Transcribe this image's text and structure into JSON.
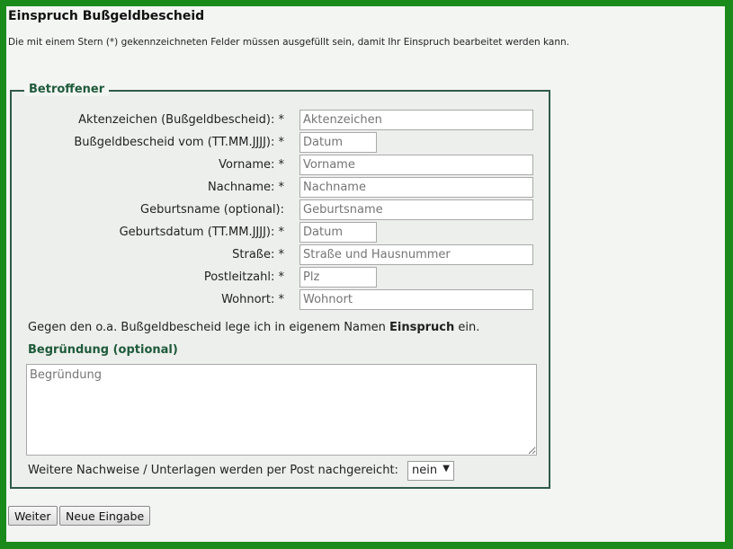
{
  "header": {
    "title": "Einspruch Bußgeldbescheid",
    "note": "Die mit einem Stern (*) gekennzeichneten Felder müssen ausgefüllt sein, damit Ihr Einspruch bearbeitet werden kann."
  },
  "form": {
    "legend": "Betroffener",
    "fields": [
      {
        "label": "Aktenzeichen (Bußgeldbescheid): *",
        "placeholder": "Aktenzeichen"
      },
      {
        "label": "Bußgeldbescheid vom (TT.MM.JJJJ): *",
        "placeholder": "Datum"
      },
      {
        "label": "Vorname: *",
        "placeholder": "Vorname"
      },
      {
        "label": "Nachname: *",
        "placeholder": "Nachname"
      },
      {
        "label": "Geburtsname (optional):",
        "placeholder": "Geburtsname"
      },
      {
        "label": "Geburtsdatum (TT.MM.JJJJ): *",
        "placeholder": "Datum"
      },
      {
        "label": "Straße: *",
        "placeholder": "Straße und Hausnummer"
      },
      {
        "label": "Postleitzahl: *",
        "placeholder": "Plz"
      },
      {
        "label": "Wohnort: *",
        "placeholder": "Wohnort"
      }
    ],
    "statement_prefix": "Gegen den o.a. Bußgeldbescheid lege ich in eigenem Namen ",
    "statement_bold": "Einspruch",
    "statement_suffix": " ein.",
    "reason_heading": "Begründung (optional)",
    "reason_placeholder": "Begründung",
    "post_label": "Weitere Nachweise / Unterlagen werden per Post nachgereicht:",
    "post_selected": "nein"
  },
  "buttons": {
    "next": "Weiter",
    "reset": "Neue Eingabe"
  }
}
